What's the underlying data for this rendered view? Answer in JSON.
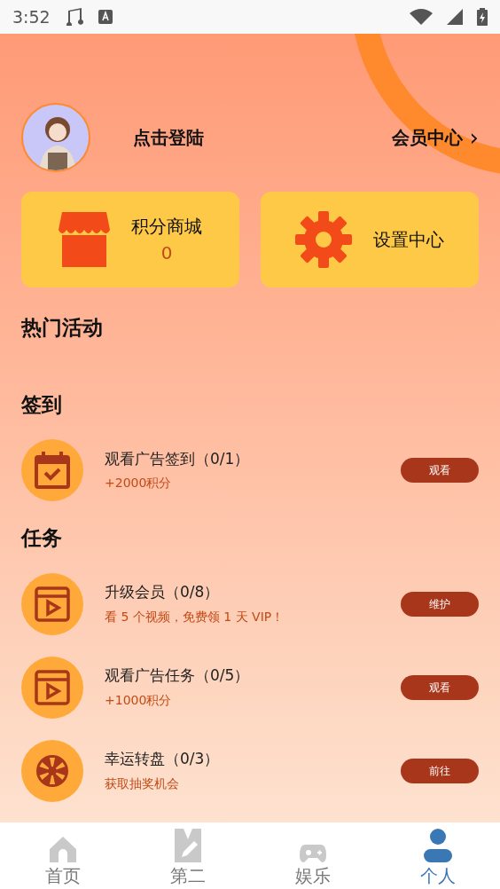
{
  "status_bar": {
    "time": "3:52"
  },
  "profile": {
    "login": "点击登陆",
    "member_center": "会员中心",
    "chevron": "›"
  },
  "shortcuts": [
    {
      "kind": "shop",
      "title": "积分商城",
      "value": "0"
    },
    {
      "kind": "settings",
      "title": "设置中心"
    }
  ],
  "hot_title": "热门活动",
  "sections": [
    {
      "title": "签到",
      "items": [
        {
          "kind": "calendar",
          "title": "观看广告签到（0/1）",
          "subtitle": "+2000积分",
          "button": "观看"
        }
      ]
    },
    {
      "title": "任务",
      "items": [
        {
          "kind": "video",
          "title": "升级会员（0/8）",
          "subtitle": "看 5 个视频，免费领 1 天 VIP！",
          "button": "维护"
        },
        {
          "kind": "video",
          "title": "观看广告任务（0/5）",
          "subtitle": "+1000积分",
          "button": "观看"
        },
        {
          "kind": "wheel",
          "title": "幸运转盘（0/3）",
          "subtitle": "获取抽奖机会",
          "button": "前往"
        }
      ]
    }
  ],
  "tabs": [
    {
      "kind": "home",
      "label": "首页",
      "selected": false
    },
    {
      "kind": "edit",
      "label": "第二",
      "selected": false
    },
    {
      "kind": "game",
      "label": "娱乐",
      "selected": false
    },
    {
      "kind": "person",
      "label": "个人",
      "selected": true
    }
  ]
}
